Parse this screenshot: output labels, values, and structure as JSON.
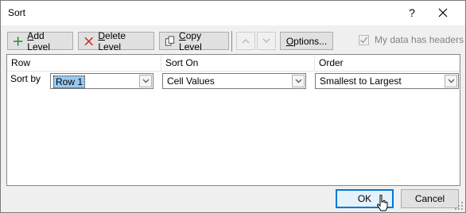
{
  "window": {
    "title": "Sort",
    "help_glyph": "?"
  },
  "toolbar": {
    "add_level": {
      "label_mnemonic": "A",
      "label_rest": "dd Level"
    },
    "delete_level": {
      "label_mnemonic": "D",
      "label_rest": "elete Level"
    },
    "copy_level": {
      "label_mnemonic": "C",
      "label_rest": "opy Level"
    },
    "move_up_icon": "chevron-up-icon",
    "move_down_icon": "chevron-down-icon",
    "options": {
      "label_mnemonic": "O",
      "label_rest": "ptions..."
    },
    "headers_checkbox": {
      "label": "My data has headers",
      "mnemonic": "h",
      "checked": true,
      "enabled": false
    }
  },
  "grid": {
    "columns": [
      "Row",
      "Sort On",
      "Order"
    ],
    "levels": [
      {
        "row_label": "Sort by",
        "column_value": "Row 1",
        "sort_on": "Cell Values",
        "order": "Smallest to Largest"
      }
    ]
  },
  "footer": {
    "ok_label": "OK",
    "cancel_label": "Cancel"
  },
  "colors": {
    "add_icon": "#2e8b2e",
    "delete_icon": "#c42b1c",
    "selection": "#99c9ef",
    "primary_border": "#0078d7"
  }
}
